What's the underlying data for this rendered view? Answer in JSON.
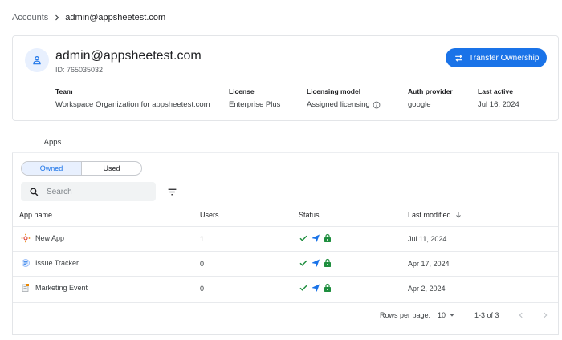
{
  "breadcrumb": {
    "parent": "Accounts",
    "current": "admin@appsheetest.com"
  },
  "user": {
    "email": "admin@appsheetest.com",
    "id": "ID: 765035032",
    "transfer_label": "Transfer Ownership",
    "fields": {
      "team": {
        "label": "Team",
        "value": "Workspace Organization for appsheetest.com"
      },
      "license": {
        "label": "License",
        "value": "Enterprise Plus"
      },
      "licensing_model": {
        "label": "Licensing model",
        "value": "Assigned licensing"
      },
      "auth_provider": {
        "label": "Auth provider",
        "value": "google"
      },
      "last_active": {
        "label": "Last active",
        "value": "Jul 16, 2024"
      }
    }
  },
  "tabs": [
    {
      "label": "Apps"
    }
  ],
  "toggle": {
    "owned": "Owned",
    "used": "Used"
  },
  "search": {
    "placeholder": "Search"
  },
  "table": {
    "columns": {
      "app_name": "App name",
      "users": "Users",
      "status": "Status",
      "last_modified": "Last modified"
    },
    "rows": [
      {
        "name": "New App",
        "users": "1",
        "last_modified": "Jul 11, 2024"
      },
      {
        "name": "Issue Tracker",
        "users": "0",
        "last_modified": "Apr 17, 2024"
      },
      {
        "name": "Marketing Event",
        "users": "0",
        "last_modified": "Apr 2, 2024"
      }
    ]
  },
  "pagination": {
    "rows_per_page_label": "Rows per page:",
    "rows_per_page": "10",
    "range": "1-3 of 3"
  },
  "colors": {
    "primary": "#1a73e8",
    "success": "#1e8e3e",
    "deploy": "#1a73e8"
  },
  "icons": [
    "chevron-right-icon",
    "person-icon",
    "transfer-icon",
    "info-icon",
    "search-icon",
    "filter-icon",
    "arrow-down-icon",
    "check-icon",
    "deploy-icon",
    "lock-icon",
    "dropdown-icon",
    "chevron-left-icon"
  ]
}
